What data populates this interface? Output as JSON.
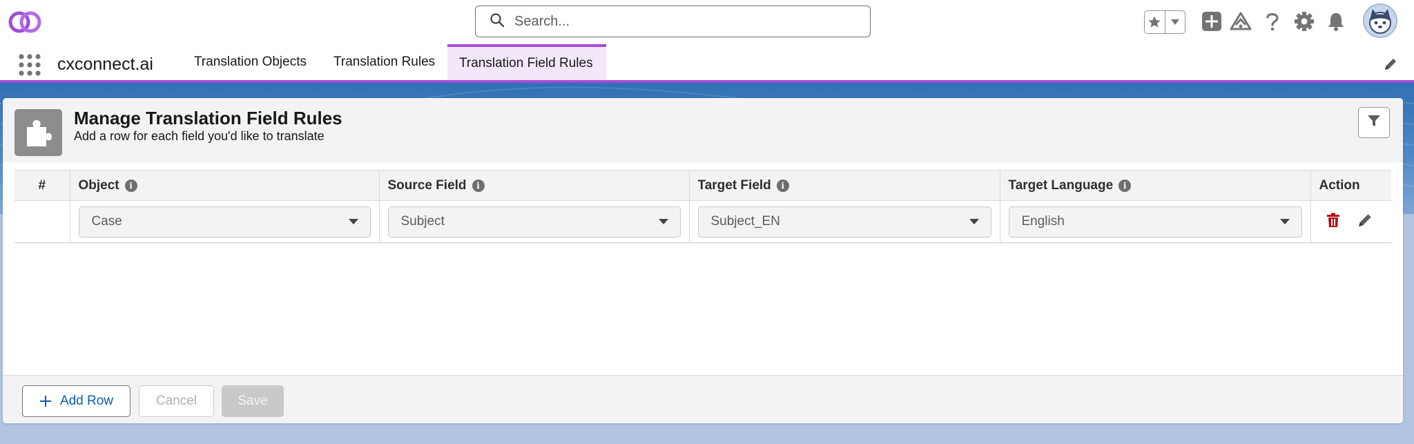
{
  "header": {
    "search_placeholder": "Search...",
    "icons": [
      "logo-icon",
      "search-icon",
      "favorites-star-icon",
      "favorites-dropdown-icon",
      "global-add-icon",
      "trailhead-icon",
      "help-icon",
      "setup-gear-icon",
      "notifications-bell-icon",
      "user-avatar"
    ]
  },
  "nav": {
    "app_name": "cxconnect.ai",
    "tabs": [
      {
        "label": "Translation Objects",
        "active": false
      },
      {
        "label": "Translation Rules",
        "active": false
      },
      {
        "label": "Translation Field Rules",
        "active": true
      }
    ]
  },
  "card": {
    "title": "Manage Translation Field Rules",
    "subtitle": "Add a row for each field you'd like to translate"
  },
  "table": {
    "columns": {
      "num": "#",
      "object": "Object",
      "source_field": "Source Field",
      "target_field": "Target Field",
      "target_language": "Target Language",
      "action": "Action"
    },
    "rows": [
      {
        "num": "",
        "object": "Case",
        "source_field": "Subject",
        "target_field": "Subject_EN",
        "target_language": "English"
      }
    ]
  },
  "footer": {
    "add_row": "Add Row",
    "cancel": "Cancel",
    "save": "Save"
  },
  "colors": {
    "accent": "#a64bd8",
    "brand_blue": "#0b5cab",
    "delete_red": "#ba0517"
  }
}
